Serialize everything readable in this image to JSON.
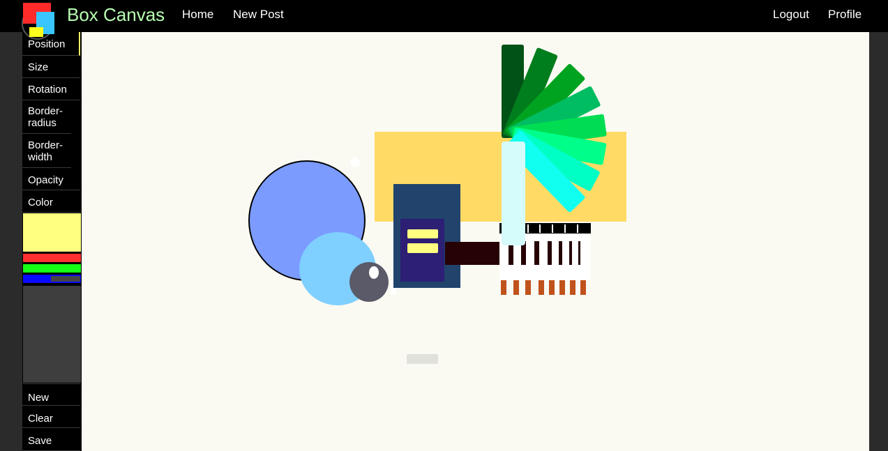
{
  "app": {
    "title": "Box Canvas"
  },
  "nav": {
    "home": "Home",
    "new_post": "New Post",
    "logout": "Logout",
    "profile": "Profile"
  },
  "sidebar": {
    "items": [
      {
        "label": "Position"
      },
      {
        "label": "Size"
      },
      {
        "label": "Rotation"
      },
      {
        "label": "Border-radius"
      },
      {
        "label": "Border-width"
      },
      {
        "label": "Opacity"
      },
      {
        "label": "Color"
      }
    ],
    "actions": {
      "new": "New",
      "clear": "Clear",
      "save": "Save"
    }
  },
  "color_picker": {
    "preview_color": "#ffff80",
    "red_color": "#ff3030",
    "green_color": "#16ff16",
    "blue_color": "#0a0aff"
  },
  "theme": {
    "topbar": "#000000",
    "brand_color": "#b7ffb0",
    "canvas_bg": "#fafaf3"
  }
}
